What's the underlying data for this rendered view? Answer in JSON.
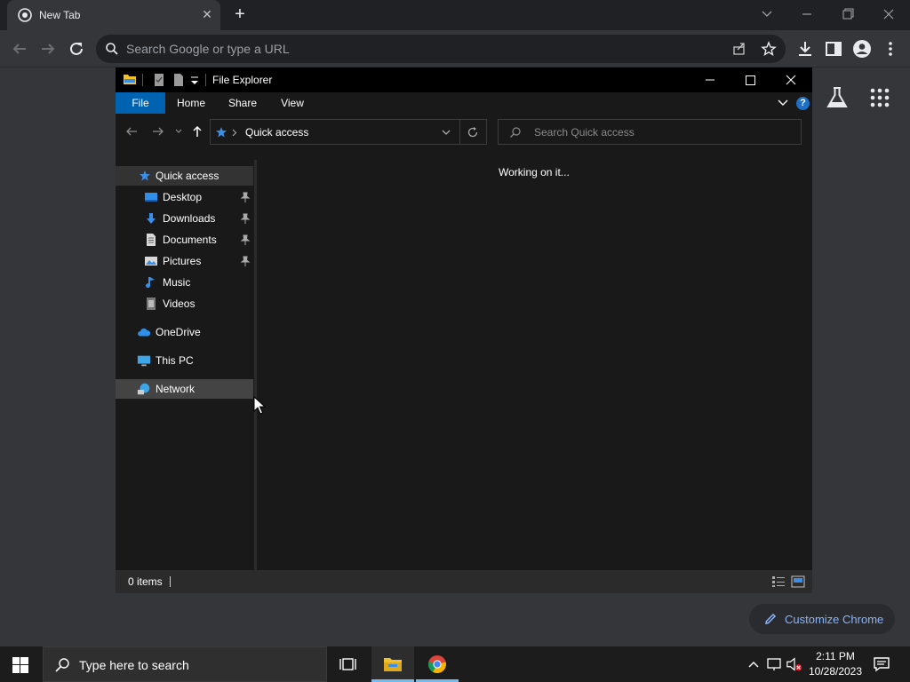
{
  "browser": {
    "tab_title": "New Tab",
    "tab_close": "✕",
    "new_tab": "+",
    "omnibox_placeholder": "Search Google or type a URL",
    "customize_label": "Customize Chrome"
  },
  "explorer": {
    "title": "File Explorer",
    "ribbon_tabs": [
      "File",
      "Home",
      "Share",
      "View"
    ],
    "help": "?",
    "address": "Quick access",
    "search_placeholder": "Search Quick access",
    "nav": {
      "quick_access": "Quick access",
      "desktop": "Desktop",
      "downloads": "Downloads",
      "documents": "Documents",
      "pictures": "Pictures",
      "music": "Music",
      "videos": "Videos",
      "onedrive": "OneDrive",
      "this_pc": "This PC",
      "network": "Network"
    },
    "content_status": "Working on it...",
    "status_items": "0 items"
  },
  "taskbar": {
    "search_placeholder": "Type here to search",
    "time": "2:11 PM",
    "date": "10/28/2023"
  },
  "colors": {
    "accent_blue": "#0063b1",
    "chrome_link": "#8ab4f8",
    "folder_yellow": "#f1c12d"
  }
}
